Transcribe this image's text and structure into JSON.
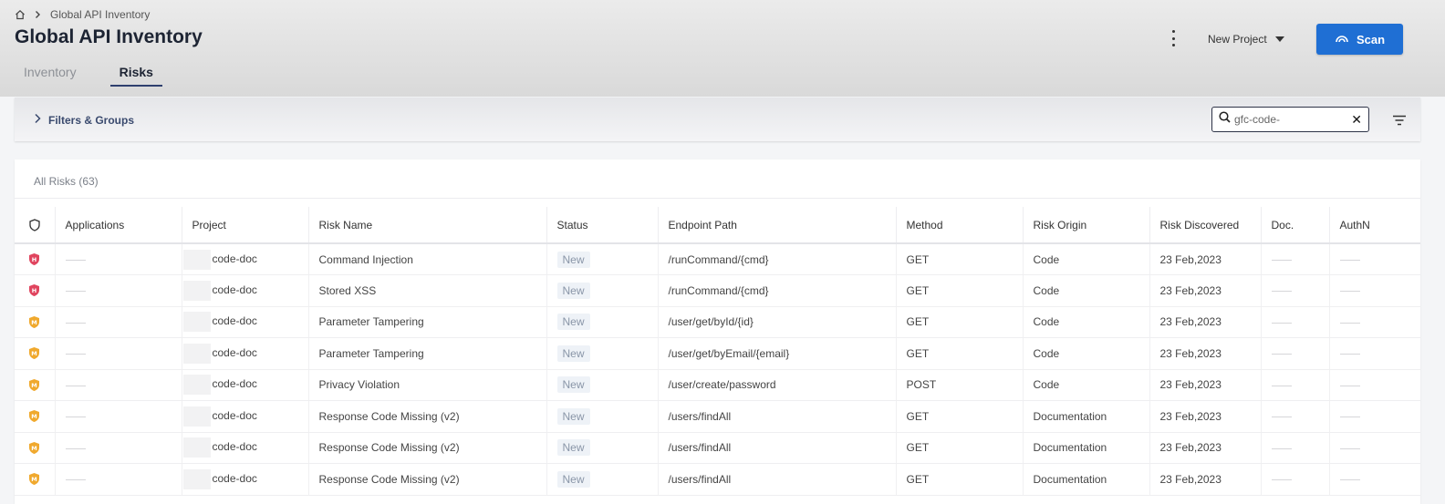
{
  "breadcrumb": {
    "current": "Global API Inventory"
  },
  "page": {
    "title": "Global API Inventory"
  },
  "tabs": [
    {
      "label": "Inventory",
      "active": false
    },
    {
      "label": "Risks",
      "active": true
    }
  ],
  "header": {
    "project_select": "New Project",
    "scan_label": "Scan"
  },
  "filters": {
    "toggle_label": "Filters & Groups"
  },
  "search": {
    "value": "gfc-code-",
    "placeholder": ""
  },
  "risks": {
    "count_label": "All Risks (63)",
    "columns": [
      "Applications",
      "Project",
      "Risk Name",
      "Status",
      "Endpoint Path",
      "Method",
      "Risk Origin",
      "Risk Discovered",
      "Doc.",
      "AuthN"
    ],
    "rows": [
      {
        "severity": "H",
        "severity_color": "#e0455f",
        "project": "code-doc",
        "risk_name": "Command Injection",
        "status": "New",
        "endpoint": "/runCommand/{cmd}",
        "method": "GET",
        "origin": "Code",
        "discovered": "23 Feb,2023"
      },
      {
        "severity": "H",
        "severity_color": "#e0455f",
        "project": "code-doc",
        "risk_name": "Stored XSS",
        "status": "New",
        "endpoint": "/runCommand/{cmd}",
        "method": "GET",
        "origin": "Code",
        "discovered": "23 Feb,2023"
      },
      {
        "severity": "M",
        "severity_color": "#f0a92e",
        "project": "code-doc",
        "risk_name": "Parameter Tampering",
        "status": "New",
        "endpoint": "/user/get/byId/{id}",
        "method": "GET",
        "origin": "Code",
        "discovered": "23 Feb,2023"
      },
      {
        "severity": "M",
        "severity_color": "#f0a92e",
        "project": "code-doc",
        "risk_name": "Parameter Tampering",
        "status": "New",
        "endpoint": "/user/get/byEmail/{email}",
        "method": "GET",
        "origin": "Code",
        "discovered": "23 Feb,2023"
      },
      {
        "severity": "M",
        "severity_color": "#f0a92e",
        "project": "code-doc",
        "risk_name": "Privacy Violation",
        "status": "New",
        "endpoint": "/user/create/password",
        "method": "POST",
        "origin": "Code",
        "discovered": "23 Feb,2023"
      },
      {
        "severity": "M",
        "severity_color": "#f0a92e",
        "project": "code-doc",
        "risk_name": "Response Code Missing (v2)",
        "status": "New",
        "endpoint": "/users/findAll",
        "method": "GET",
        "origin": "Documentation",
        "discovered": "23 Feb,2023"
      },
      {
        "severity": "M",
        "severity_color": "#f0a92e",
        "project": "code-doc",
        "risk_name": "Response Code Missing (v2)",
        "status": "New",
        "endpoint": "/users/findAll",
        "method": "GET",
        "origin": "Documentation",
        "discovered": "23 Feb,2023"
      },
      {
        "severity": "M",
        "severity_color": "#f0a92e",
        "project": "code-doc",
        "risk_name": "Response Code Missing (v2)",
        "status": "New",
        "endpoint": "/users/findAll",
        "method": "GET",
        "origin": "Documentation",
        "discovered": "23 Feb,2023"
      }
    ]
  },
  "colors": {
    "accent": "#1f6fd4",
    "tab_active": "#2e3f6e"
  }
}
